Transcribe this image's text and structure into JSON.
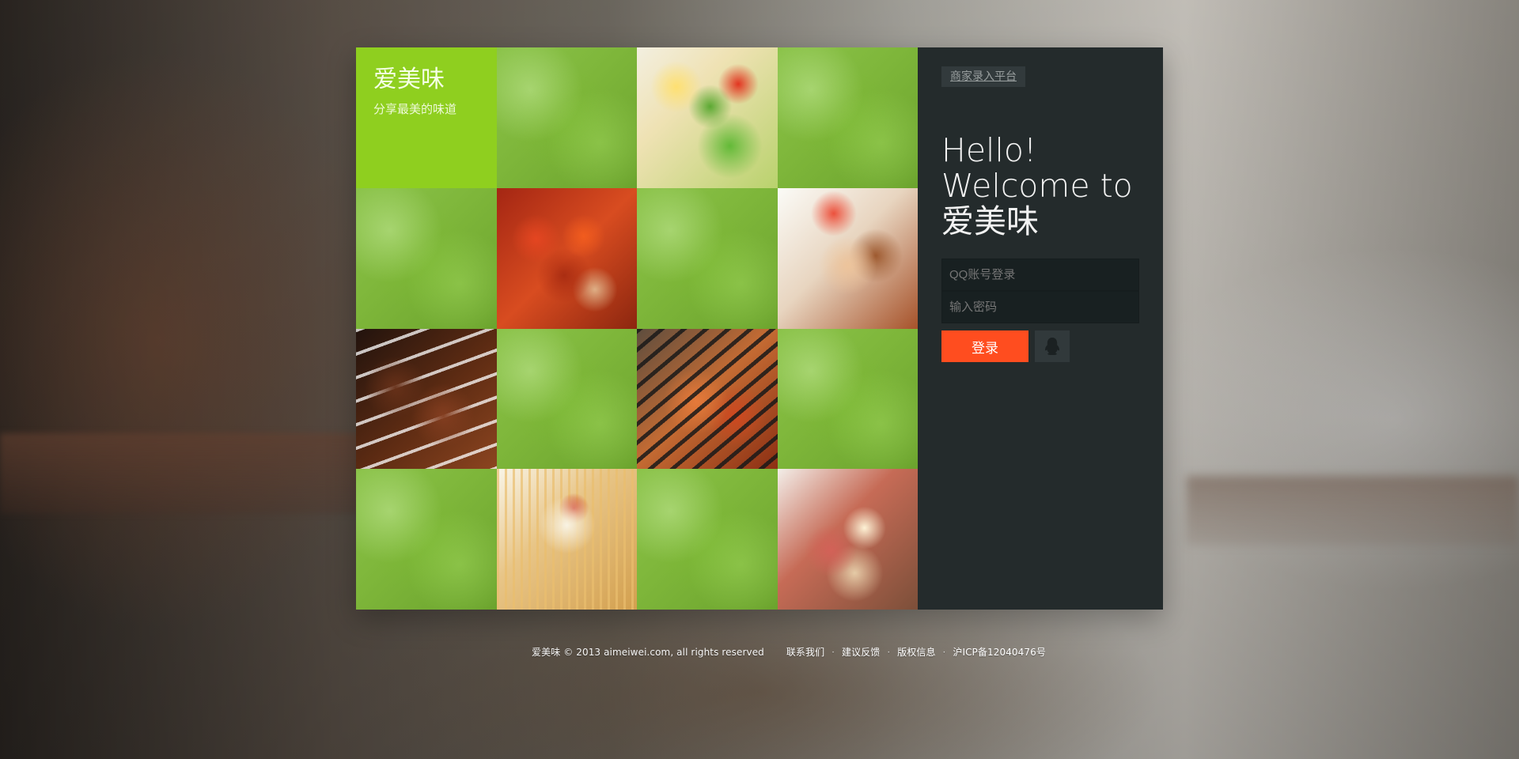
{
  "brand": {
    "title": "爱美味",
    "subtitle": "分享最美的味道"
  },
  "panel": {
    "merchant_link": "商家录入平台",
    "welcome_line_1": "Hello!",
    "welcome_line_2": "Welcome to",
    "welcome_line_3": "爱美味",
    "account_placeholder": "QQ账号登录",
    "password_placeholder": "输入密码",
    "login_button": "登录",
    "qq_icon": "qq-penguin-icon"
  },
  "footer": {
    "copyright": "爱美味 © 2013 aimeiwei.com, all rights reserved",
    "links": [
      "联系我们",
      "建议反馈",
      "版权信息",
      "沪ICP备12040476号"
    ],
    "separator": "·"
  },
  "colors": {
    "brand_green": "#8fcf1f",
    "panel_background": "#242b2c",
    "login_orange": "#ff4d1f"
  }
}
